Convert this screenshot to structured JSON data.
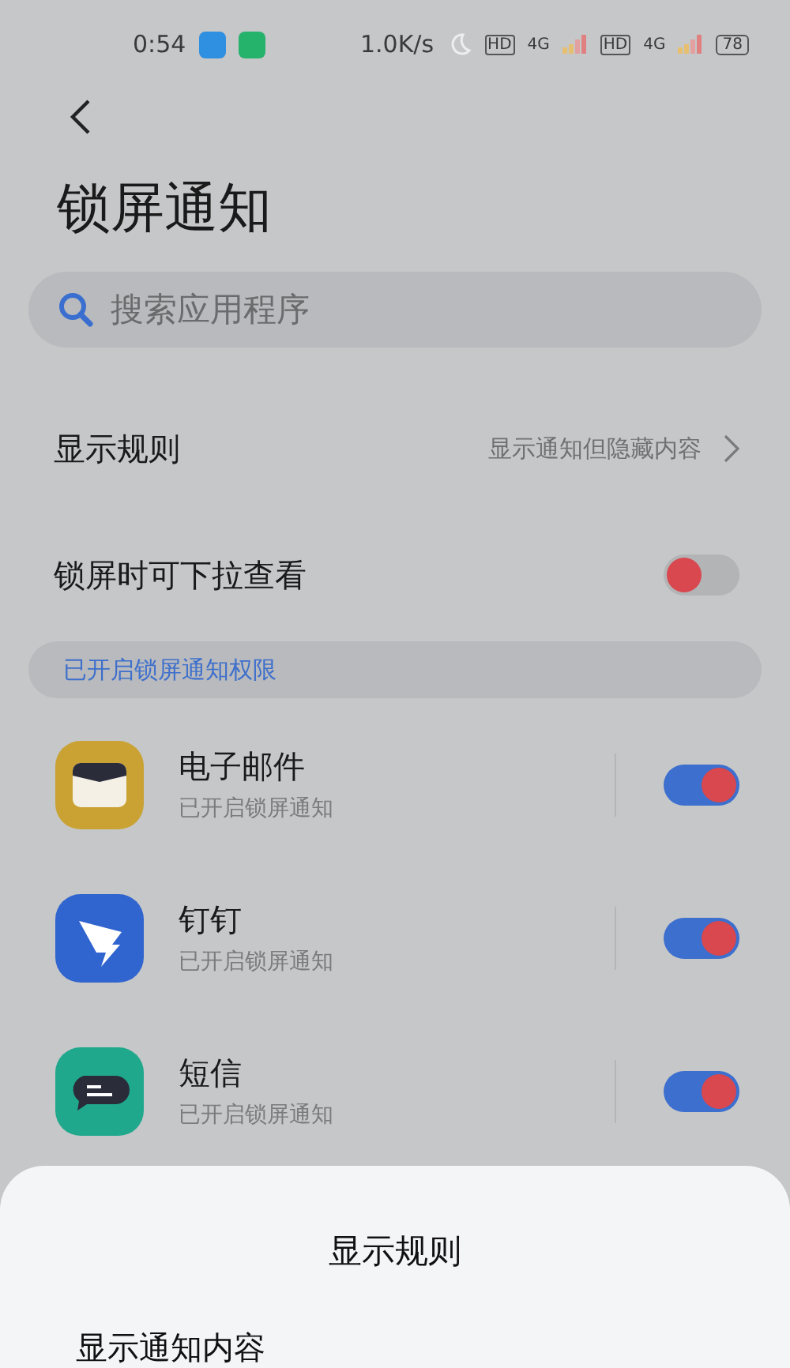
{
  "status_bar": {
    "time": "0:54",
    "speed": "1.0K/s",
    "sims": [
      {
        "hd": "HD",
        "network": "4G"
      },
      {
        "hd": "HD",
        "network": "4G"
      }
    ],
    "battery": "78"
  },
  "title": "锁屏通知",
  "search": {
    "placeholder": "搜索应用程序"
  },
  "settings": [
    {
      "kind": "link",
      "label": "显示规则",
      "value": "显示通知但隐藏内容"
    },
    {
      "kind": "toggle",
      "label": "锁屏时可下拉查看",
      "on": false
    }
  ],
  "section": "已开启锁屏通知权限",
  "apps": [
    {
      "kind": "mail",
      "name": "电子邮件",
      "status": "已开启锁屏通知",
      "on": true
    },
    {
      "kind": "dingtalk",
      "name": "钉钉",
      "status": "已开启锁屏通知",
      "on": true
    },
    {
      "kind": "sms",
      "name": "短信",
      "status": "已开启锁屏通知",
      "on": true
    }
  ],
  "sheet": {
    "title": "显示规则",
    "options": [
      "显示通知内容"
    ]
  }
}
